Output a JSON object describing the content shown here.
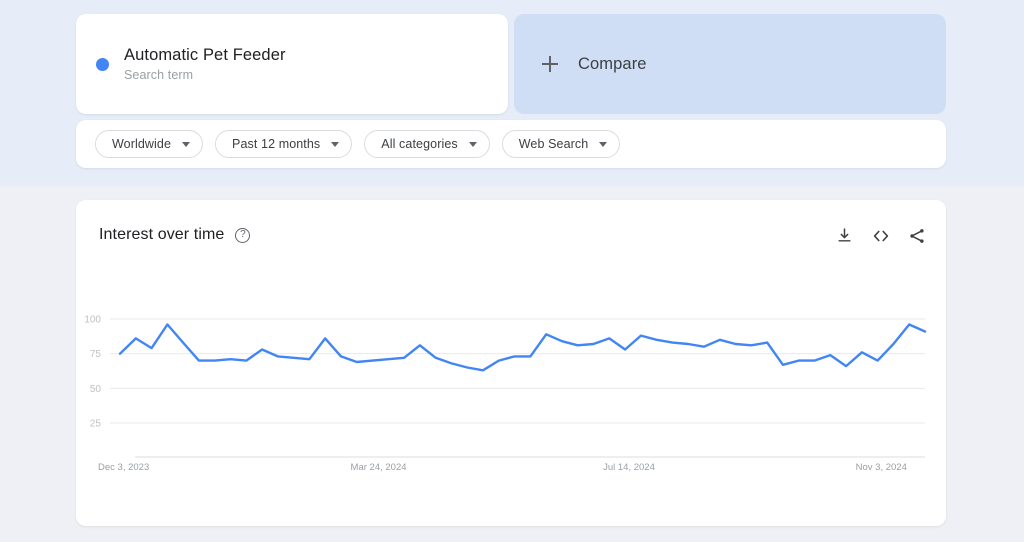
{
  "theme": {
    "accent": "#4285f4",
    "top_band_bg": "#e7edf8",
    "page_bg": "#eef0f5",
    "card_bg": "#ffffff",
    "compare_bg": "#cfdef5"
  },
  "term": {
    "title": "Automatic Pet Feeder",
    "subtitle": "Search term",
    "dot_color": "#4285f4"
  },
  "compare": {
    "label": "Compare",
    "icon": "plus-icon"
  },
  "filters": [
    {
      "label": "Worldwide",
      "icon": "chevron-down-icon"
    },
    {
      "label": "Past 12 months",
      "icon": "chevron-down-icon"
    },
    {
      "label": "All categories",
      "icon": "chevron-down-icon"
    },
    {
      "label": "Web Search",
      "icon": "chevron-down-icon"
    }
  ],
  "chart_card": {
    "title": "Interest over time",
    "help_icon": "help-circle-icon",
    "help_glyph": "?",
    "actions": [
      {
        "name": "download-icon",
        "title": "Download"
      },
      {
        "name": "embed-code-icon",
        "title": "Embed"
      },
      {
        "name": "share-icon",
        "title": "Share"
      }
    ]
  },
  "chart_data": {
    "type": "line",
    "title": "Interest over time",
    "xlabel": "",
    "ylabel": "",
    "ylim": [
      0,
      105
    ],
    "yticks": [
      100,
      75,
      50,
      25
    ],
    "grid": true,
    "legend": "Automatic Pet Feeder",
    "series_color": "#4285f4",
    "xtick_labels": [
      "Dec 3, 2023",
      "Mar 24, 2024",
      "Jul 14, 2024",
      "Nov 3, 2024"
    ],
    "xtick_indices": [
      0,
      16,
      32,
      48
    ],
    "categories": [
      "Dec 3, 2023",
      "Dec 10, 2023",
      "Dec 17, 2023",
      "Dec 24, 2023",
      "Dec 31, 2023",
      "Jan 7, 2024",
      "Jan 14, 2024",
      "Jan 21, 2024",
      "Jan 28, 2024",
      "Feb 4, 2024",
      "Feb 11, 2024",
      "Feb 18, 2024",
      "Feb 25, 2024",
      "Mar 3, 2024",
      "Mar 10, 2024",
      "Mar 17, 2024",
      "Mar 24, 2024",
      "Mar 31, 2024",
      "Apr 7, 2024",
      "Apr 14, 2024",
      "Apr 21, 2024",
      "Apr 28, 2024",
      "May 5, 2024",
      "May 12, 2024",
      "May 19, 2024",
      "May 26, 2024",
      "Jun 2, 2024",
      "Jun 9, 2024",
      "Jun 16, 2024",
      "Jun 23, 2024",
      "Jun 30, 2024",
      "Jul 7, 2024",
      "Jul 14, 2024",
      "Jul 21, 2024",
      "Jul 28, 2024",
      "Aug 4, 2024",
      "Aug 11, 2024",
      "Aug 18, 2024",
      "Aug 25, 2024",
      "Sep 1, 2024",
      "Sep 8, 2024",
      "Sep 15, 2024",
      "Sep 22, 2024",
      "Sep 29, 2024",
      "Oct 6, 2024",
      "Oct 13, 2024",
      "Oct 20, 2024",
      "Oct 27, 2024",
      "Nov 3, 2024",
      "Nov 10, 2024",
      "Nov 17, 2024",
      "Nov 24, 2024"
    ],
    "values": [
      75,
      86,
      79,
      96,
      83,
      70,
      70,
      71,
      70,
      78,
      73,
      72,
      71,
      86,
      73,
      69,
      70,
      71,
      72,
      81,
      72,
      68,
      65,
      63,
      70,
      73,
      73,
      89,
      84,
      81,
      82,
      86,
      78,
      88,
      85,
      83,
      82,
      80,
      85,
      82,
      81,
      83,
      67,
      70,
      70,
      74,
      66,
      76,
      70,
      82,
      96,
      91
    ]
  }
}
